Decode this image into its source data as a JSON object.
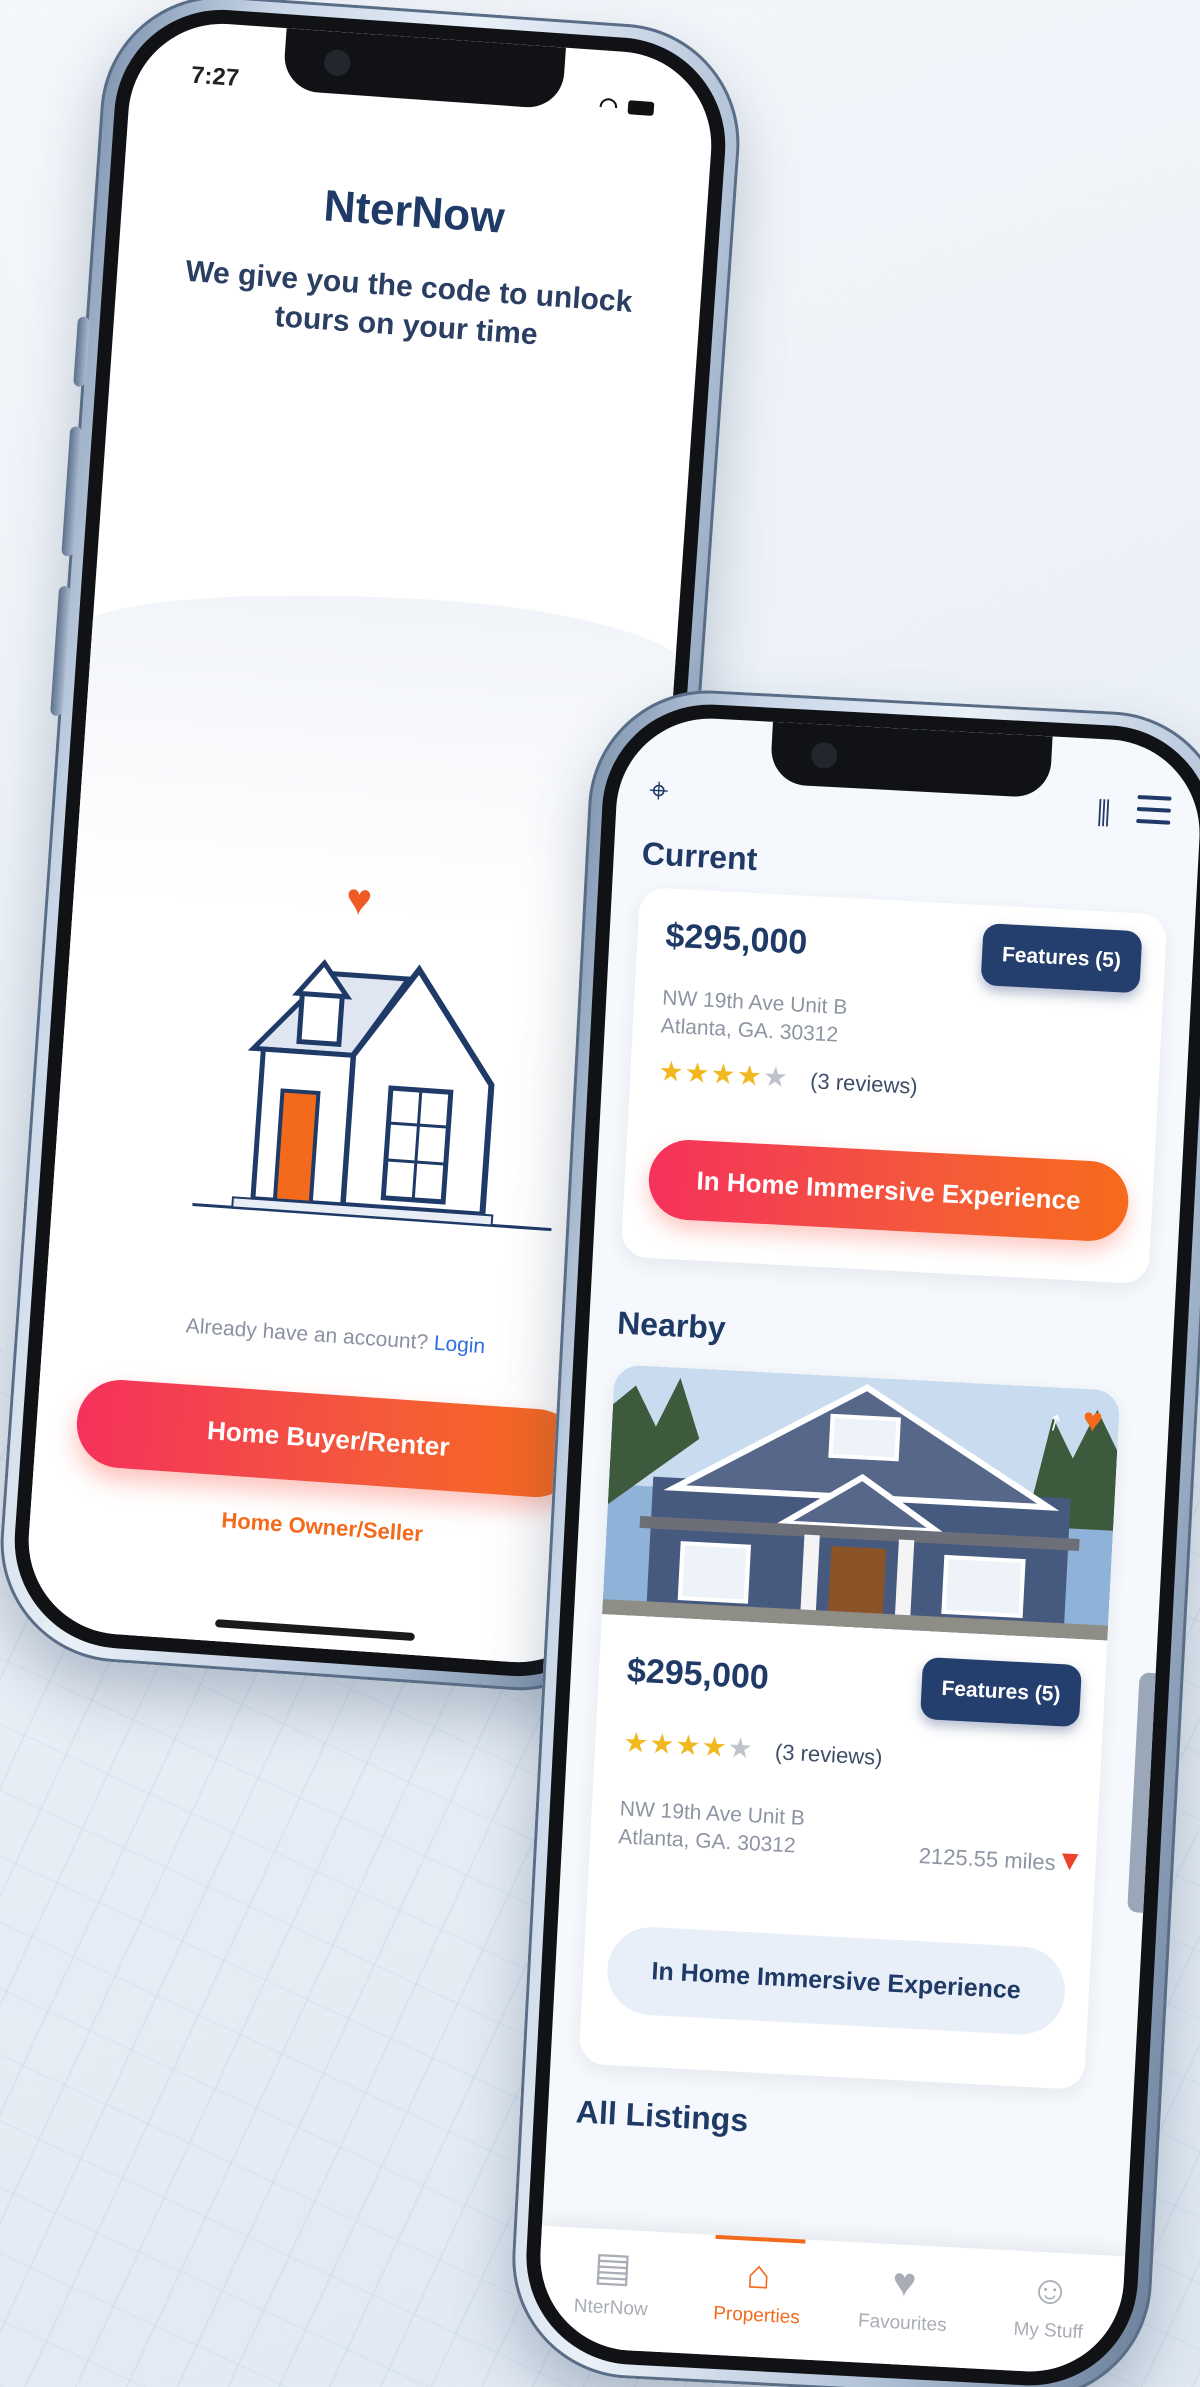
{
  "colors": {
    "primary_navy": "#1f3a66",
    "accent_orange": "#f36a1c",
    "accent_pink": "#f5315c",
    "star_yellow": "#f2b81f"
  },
  "phone1": {
    "status": {
      "time": "7:27"
    },
    "app_title": "NterNow",
    "tagline": "We give you the code to unlock tours on your time",
    "login_prompt": "Already have an account?",
    "login_link": "Login",
    "buyer_button": "Home Buyer/Renter",
    "owner_link": "Home Owner/Seller",
    "icons": [
      "heart-icon",
      "house-illustration",
      "wifi-icon",
      "battery-icon"
    ]
  },
  "phone2": {
    "header": {
      "icons": [
        "map-icon",
        "filter-icon",
        "menu-icon"
      ]
    },
    "current": {
      "section_title": "Current",
      "price": "$295,000",
      "features": "Features (5)",
      "address_line1": "NW 19th Ave Unit B",
      "address_line2": "Atlanta, GA. 30312",
      "rating": 4,
      "rating_max": 5,
      "reviews": "(3 reviews)",
      "cta": "In Home Immersive Experience"
    },
    "nearby": {
      "section_title": "Nearby",
      "price": "$295,000",
      "features": "Features (5)",
      "rating": 4,
      "rating_max": 5,
      "reviews": "(3 reviews)",
      "address_line1": "NW 19th Ave Unit B",
      "address_line2": "Atlanta, GA. 30312",
      "distance": "2125.55 miles",
      "cta": "In Home Immersive Experience"
    },
    "all_listings_title": "All Listings",
    "tabs": [
      {
        "label": "NterNow",
        "icon": "nternow-icon",
        "active": false
      },
      {
        "label": "Properties",
        "icon": "houses-icon",
        "active": true
      },
      {
        "label": "Favourites",
        "icon": "heart-icon",
        "active": false
      },
      {
        "label": "My Stuff",
        "icon": "user-icon",
        "active": false
      }
    ]
  }
}
